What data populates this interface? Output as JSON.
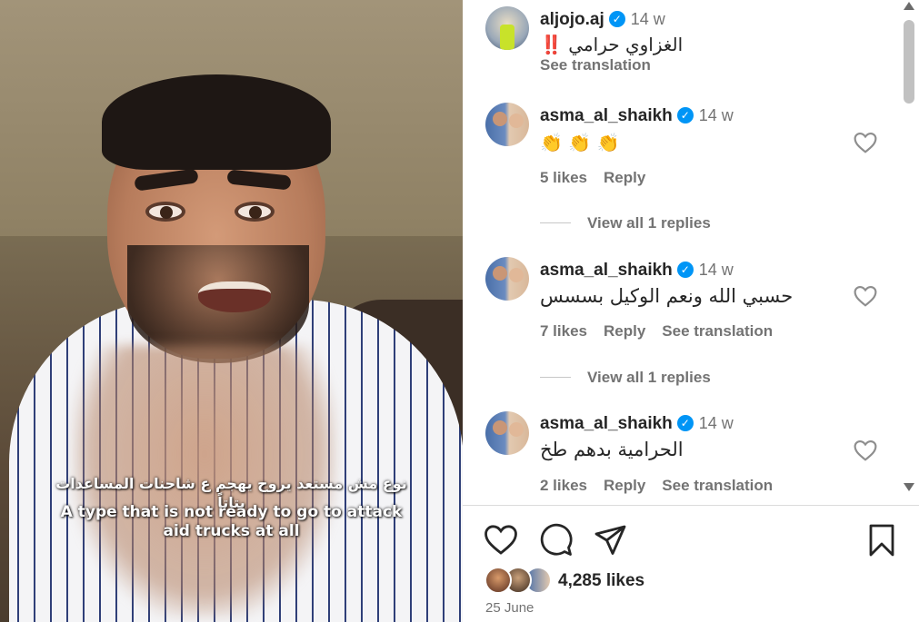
{
  "post": {
    "author": "aljojo.aj",
    "time": "14 w",
    "caption": "الغزاوي حرامي ‼️",
    "see_translation": "See translation"
  },
  "video": {
    "subtitle_ar": "نوع مش مستعد يروح يهجم ع شاحنات المساعدات بتاتاً",
    "subtitle_en": "A type that is not ready to go to attack aid trucks at all"
  },
  "comments": [
    {
      "username": "asma_al_shaikh",
      "time": "14 w",
      "text": "👏 👏 👏",
      "likes": "5 likes",
      "reply": "Reply",
      "see_translation": "",
      "view_replies": "View all 1 replies"
    },
    {
      "username": "asma_al_shaikh",
      "time": "14 w",
      "text": "حسبي الله ونعم الوكيل بسسس",
      "likes": "7 likes",
      "reply": "Reply",
      "see_translation": "See translation",
      "view_replies": "View all 1 replies"
    },
    {
      "username": "asma_al_shaikh",
      "time": "14 w",
      "text": "الحرامية بدهم طخ",
      "likes": "2 likes",
      "reply": "Reply",
      "see_translation": "See translation",
      "view_replies": ""
    }
  ],
  "footer": {
    "likes_count": "4,285 likes",
    "date": "25 June"
  },
  "icons": {
    "like": "heart-icon",
    "comment": "comment-bubble-icon",
    "share": "paper-plane-icon",
    "save": "bookmark-icon",
    "verified": "verified-badge-icon"
  },
  "colors": {
    "verified": "#0095f6",
    "secondary_text": "#737373",
    "primary_text": "#262626"
  }
}
